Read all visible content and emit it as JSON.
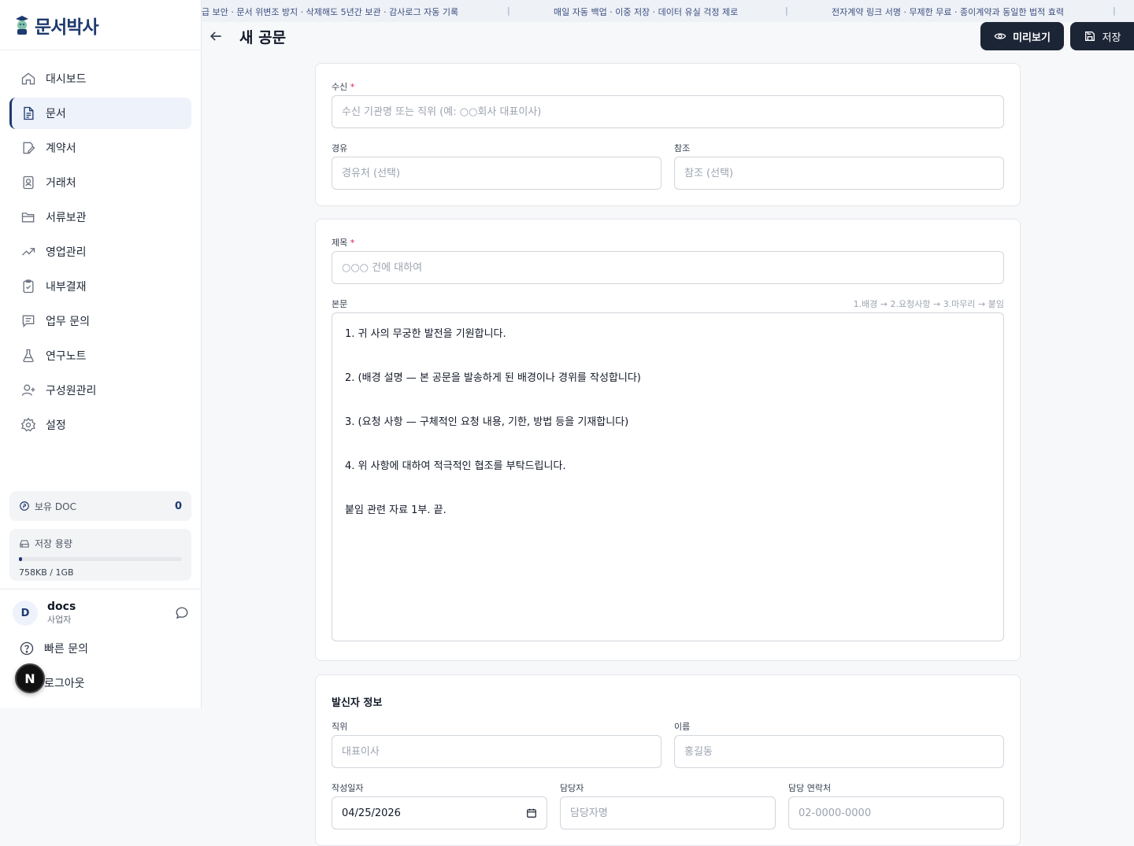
{
  "app": {
    "name": "문서박사"
  },
  "ticker": [
    "급 보안 · 문서 위변조 방지 · 삭제해도 5년간 보관 · 감사로그 자동 기록",
    "매일 자동 백업 · 이중 저장 · 데이터 유실 걱정 제로",
    "전자계약 링크 서명 · 무제한 무료 · 종이계약과 동일한 법적 효력"
  ],
  "sidebar": {
    "items": [
      {
        "label": "대시보드",
        "icon": "home-icon"
      },
      {
        "label": "문서",
        "icon": "document-icon"
      },
      {
        "label": "계약서",
        "icon": "contract-icon"
      },
      {
        "label": "거래처",
        "icon": "contact-icon"
      },
      {
        "label": "서류보관",
        "icon": "folder-icon"
      },
      {
        "label": "영업관리",
        "icon": "trend-icon"
      },
      {
        "label": "내부결재",
        "icon": "clipboard-check-icon"
      },
      {
        "label": "업무 문의",
        "icon": "message-icon"
      },
      {
        "label": "연구노트",
        "icon": "flask-icon"
      },
      {
        "label": "구성원관리",
        "icon": "user-plus-icon"
      },
      {
        "label": "설정",
        "icon": "gear-icon"
      }
    ],
    "active_index": 1,
    "doc_label": "보유 DOC",
    "doc_value": "0",
    "storage_label": "저장 용량",
    "storage_value": "758KB / 1GB",
    "storage_fraction": 0.0007,
    "user": {
      "initial": "D",
      "name": "docs",
      "role": "사업자"
    },
    "quick_inquiry": "빠른 문의",
    "logout": "로그아웃",
    "next_badge": "N"
  },
  "header": {
    "title": "새 공문",
    "preview_label": "미리보기",
    "save_label": "저장"
  },
  "recipient": {
    "label": "수신",
    "required_mark": "*",
    "placeholder": "수신 기관명 또는 직위 (예: ○○회사 대표이사)",
    "via_label": "경유",
    "via_placeholder": "경유처 (선택)",
    "cc_label": "참조",
    "cc_placeholder": "참조 (선택)"
  },
  "content": {
    "title_label": "제목",
    "required_mark": "*",
    "title_placeholder": "○○○ 건에 대하여",
    "body_label": "본문",
    "body_hint": "1.배경 → 2.요청사항 → 3.마무리 → 붙임",
    "body_lines": [
      "1. 귀 사의 무궁한 발전을 기원합니다.",
      "2. (배경 설명 — 본 공문을 발송하게 된 배경이나 경위를 작성합니다)",
      "3. (요청 사항 — 구체적인 요청 내용, 기한, 방법 등을 기재합니다)",
      "4. 위 사항에 대하여 적극적인 협조를 부탁드립니다.",
      "붙임  관련 자료 1부.  끝."
    ]
  },
  "sender": {
    "section_title": "발신자 정보",
    "position_label": "직위",
    "position_placeholder": "대표이사",
    "name_label": "이름",
    "name_placeholder": "홍길동",
    "date_label": "작성일자",
    "date_value": "04/25/2026",
    "manager_label": "담당자",
    "manager_placeholder": "담당자명",
    "contact_label": "담당 연락처",
    "contact_placeholder": "02-0000-0000"
  }
}
